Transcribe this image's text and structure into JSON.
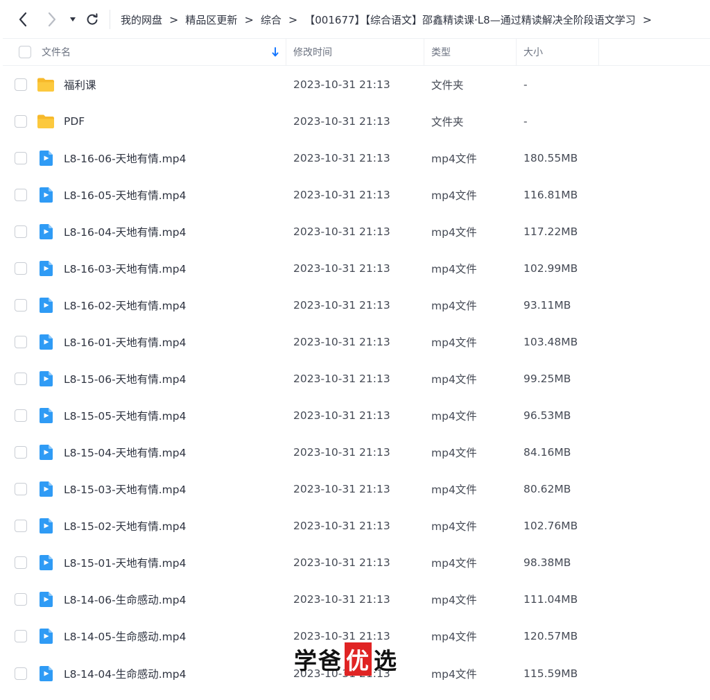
{
  "breadcrumb": [
    {
      "label": "我的网盘"
    },
    {
      "label": "精品区更新"
    },
    {
      "label": "综合"
    },
    {
      "label": "【001677】【综合语文】邵鑫精读课·L8—通过精读解决全阶段语文学习"
    }
  ],
  "table": {
    "headers": {
      "name": "文件名",
      "time": "修改时间",
      "type": "类型",
      "size": "大小"
    },
    "rows": [
      {
        "icon": "folder-icon",
        "name": "福利课",
        "time": "2023-10-31 21:13",
        "type": "文件夹",
        "size": "-"
      },
      {
        "icon": "folder-icon",
        "name": "PDF",
        "time": "2023-10-31 21:13",
        "type": "文件夹",
        "size": "-"
      },
      {
        "icon": "video-file-icon",
        "name": "L8-16-06-天地有情.mp4",
        "time": "2023-10-31 21:13",
        "type": "mp4文件",
        "size": "180.55MB"
      },
      {
        "icon": "video-file-icon",
        "name": "L8-16-05-天地有情.mp4",
        "time": "2023-10-31 21:13",
        "type": "mp4文件",
        "size": "116.81MB"
      },
      {
        "icon": "video-file-icon",
        "name": "L8-16-04-天地有情.mp4",
        "time": "2023-10-31 21:13",
        "type": "mp4文件",
        "size": "117.22MB"
      },
      {
        "icon": "video-file-icon",
        "name": "L8-16-03-天地有情.mp4",
        "time": "2023-10-31 21:13",
        "type": "mp4文件",
        "size": "102.99MB"
      },
      {
        "icon": "video-file-icon",
        "name": "L8-16-02-天地有情.mp4",
        "time": "2023-10-31 21:13",
        "type": "mp4文件",
        "size": "93.11MB"
      },
      {
        "icon": "video-file-icon",
        "name": "L8-16-01-天地有情.mp4",
        "time": "2023-10-31 21:13",
        "type": "mp4文件",
        "size": "103.48MB"
      },
      {
        "icon": "video-file-icon",
        "name": "L8-15-06-天地有情.mp4",
        "time": "2023-10-31 21:13",
        "type": "mp4文件",
        "size": "99.25MB"
      },
      {
        "icon": "video-file-icon",
        "name": "L8-15-05-天地有情.mp4",
        "time": "2023-10-31 21:13",
        "type": "mp4文件",
        "size": "96.53MB"
      },
      {
        "icon": "video-file-icon",
        "name": "L8-15-04-天地有情.mp4",
        "time": "2023-10-31 21:13",
        "type": "mp4文件",
        "size": "84.16MB"
      },
      {
        "icon": "video-file-icon",
        "name": "L8-15-03-天地有情.mp4",
        "time": "2023-10-31 21:13",
        "type": "mp4文件",
        "size": "80.62MB"
      },
      {
        "icon": "video-file-icon",
        "name": "L8-15-02-天地有情.mp4",
        "time": "2023-10-31 21:13",
        "type": "mp4文件",
        "size": "102.76MB"
      },
      {
        "icon": "video-file-icon",
        "name": "L8-15-01-天地有情.mp4",
        "time": "2023-10-31 21:13",
        "type": "mp4文件",
        "size": "98.38MB"
      },
      {
        "icon": "video-file-icon",
        "name": "L8-14-06-生命感动.mp4",
        "time": "2023-10-31 21:13",
        "type": "mp4文件",
        "size": "111.04MB"
      },
      {
        "icon": "video-file-icon",
        "name": "L8-14-05-生命感动.mp4",
        "time": "2023-10-31 21:13",
        "type": "mp4文件",
        "size": "120.57MB"
      },
      {
        "icon": "video-file-icon",
        "name": "L8-14-04-生命感动.mp4",
        "time": "2023-10-31 21:13",
        "type": "mp4文件",
        "size": "115.59MB"
      }
    ]
  },
  "watermark": {
    "part1": "学爸",
    "part2": "优",
    "part3": "选"
  },
  "colors": {
    "folder": "#f7b92b",
    "video": "#2f9bf5",
    "sort_arrow": "#1677ff"
  }
}
